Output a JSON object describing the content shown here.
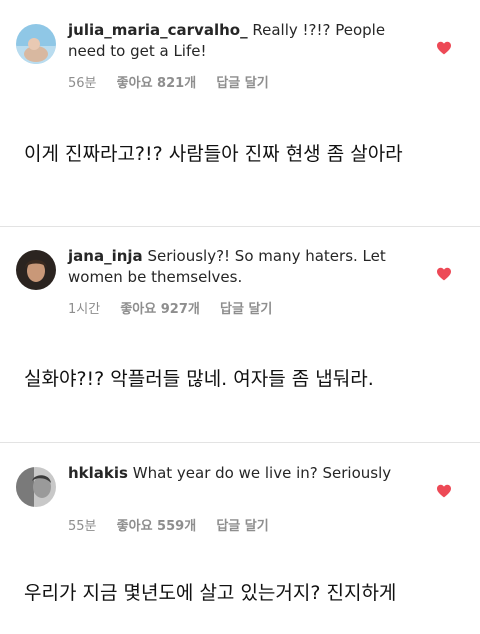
{
  "comments": [
    {
      "username": "julia_maria_carvalho_",
      "text": "Really !?!? People need to get a Life!",
      "time": "56분",
      "likes": "좋아요 821개",
      "reply": "답글 달기",
      "translation": "이게 진짜라고?!? 사람들아 진짜 현생 좀 살아라"
    },
    {
      "username": "jana_inja",
      "text": "Seriously?! So many haters. Let women be themselves.",
      "time": "1시간",
      "likes": "좋아요 927개",
      "reply": "답글 달기",
      "translation": "실화야?!? 악플러들 많네. 여자들 좀 냅둬라."
    },
    {
      "username": "hklakis",
      "text": "What year do we live in? Seriously",
      "time": "55분",
      "likes": "좋아요 559개",
      "reply": "답글 달기",
      "translation": "우리가 지금 몇년도에 살고 있는거지? 진지하게"
    }
  ],
  "colors": {
    "heart": "#ed4956",
    "meta": "#8e8e8e",
    "text": "#262626"
  }
}
